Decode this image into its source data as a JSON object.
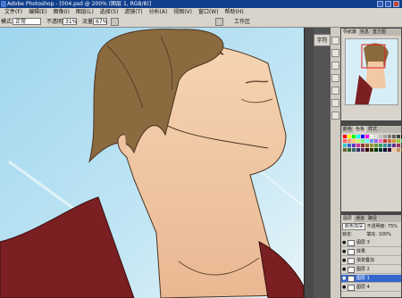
{
  "title": "Adobe Photoshop - [004.psd @ 200% (图层 1, RGB/8)]",
  "menu": [
    "文件(F)",
    "编辑(E)",
    "图像(I)",
    "图层(L)",
    "选择(S)",
    "滤镜(T)",
    "分析(A)",
    "视图(V)",
    "窗口(W)",
    "帮助(H)"
  ],
  "options": {
    "mode_label": "模式:",
    "mode_value": "正常",
    "opacity_label": "不透明度:",
    "opacity_value": "31%",
    "flow_label": "流量:",
    "flow_value": "67%",
    "workspace_label": "工作区"
  },
  "font_button": "字符",
  "navigator_tabs": [
    "导航器",
    "信息",
    "直方图"
  ],
  "swatch_tabs": [
    "颜色",
    "色板",
    "样式"
  ],
  "layers_tabs": [
    "图层",
    "通道",
    "路径"
  ],
  "layers": {
    "blend_mode": "颜色加深",
    "opacity_label": "不透明度:",
    "opacity_value": "75%",
    "lock_label": "锁定:",
    "fill_label": "填充:",
    "fill_value": "100%",
    "items": [
      {
        "name": "图层 3",
        "active": false
      },
      {
        "name": "效果",
        "active": false
      },
      {
        "name": "渐变叠加",
        "active": false
      },
      {
        "name": "图层 2",
        "active": false
      },
      {
        "name": "图层 1",
        "active": true
      },
      {
        "name": "图层 4",
        "active": false
      }
    ]
  },
  "colors": {
    "titlebar": "#103e8c",
    "selected_layer": "#3366cc",
    "canvas_bg": "#a8d8ec",
    "hair": "#8a6a3e",
    "skin": "#f2c9a4",
    "shirt": "#7a1f22"
  },
  "swatch_colors": [
    "#ff0000",
    "#ffff00",
    "#00ff00",
    "#00ffff",
    "#0000ff",
    "#ff00ff",
    "#ffffff",
    "#e0e0e0",
    "#c0c0c0",
    "#a0a0a0",
    "#808080",
    "#606060",
    "#404040",
    "#000000",
    "#ff6666",
    "#ff9966",
    "#ffcc66",
    "#ccff66",
    "#66ff99",
    "#66ffff",
    "#6699ff",
    "#9966ff",
    "#ff66cc",
    "#cc3333",
    "#cc6633",
    "#cc9933",
    "#99cc33",
    "#33cc66",
    "#33cccc",
    "#3366cc",
    "#6633cc",
    "#cc3399",
    "#993333",
    "#996633",
    "#999933",
    "#669933",
    "#339966",
    "#339999",
    "#336699",
    "#663399",
    "#993366",
    "#663333",
    "#666633",
    "#336633",
    "#336666",
    "#333366",
    "#663366",
    "#330000",
    "#333300",
    "#003300",
    "#003333",
    "#000033",
    "#330033",
    "#f2c9a4",
    "#c89060",
    "#8a6a3e"
  ]
}
